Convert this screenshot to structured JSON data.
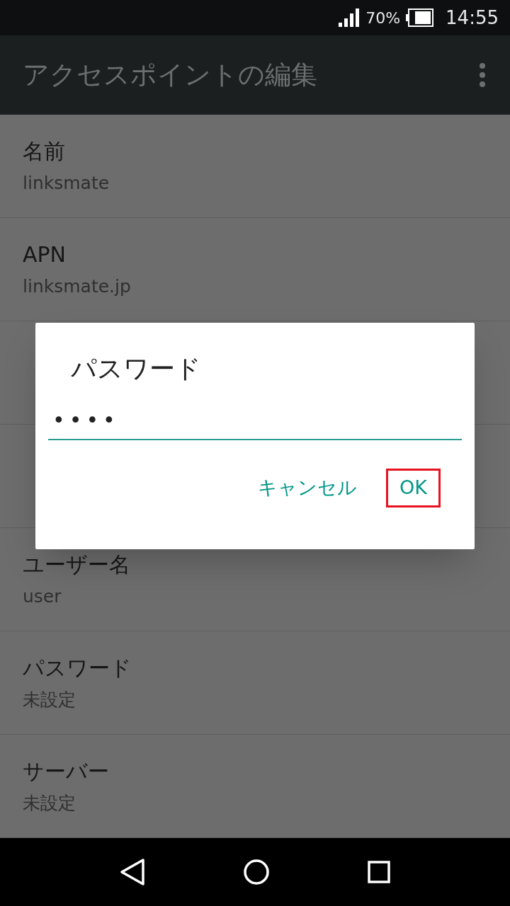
{
  "status_bar": {
    "battery": "70%",
    "time": "14:55"
  },
  "app_bar": {
    "title": "アクセスポイントの編集"
  },
  "settings": [
    {
      "label": "名前",
      "value": "linksmate"
    },
    {
      "label": "APN",
      "value": "linksmate.jp"
    },
    {
      "label": "ユーザー名",
      "value": "user"
    },
    {
      "label": "パスワード",
      "value": "未設定"
    },
    {
      "label": "サーバー",
      "value": "未設定"
    }
  ],
  "dialog": {
    "title": "パスワード",
    "value": "••••",
    "buttons": [
      {
        "label": "キャンセル",
        "highlighted": false
      },
      {
        "label": "OK",
        "highlighted": true
      }
    ]
  }
}
